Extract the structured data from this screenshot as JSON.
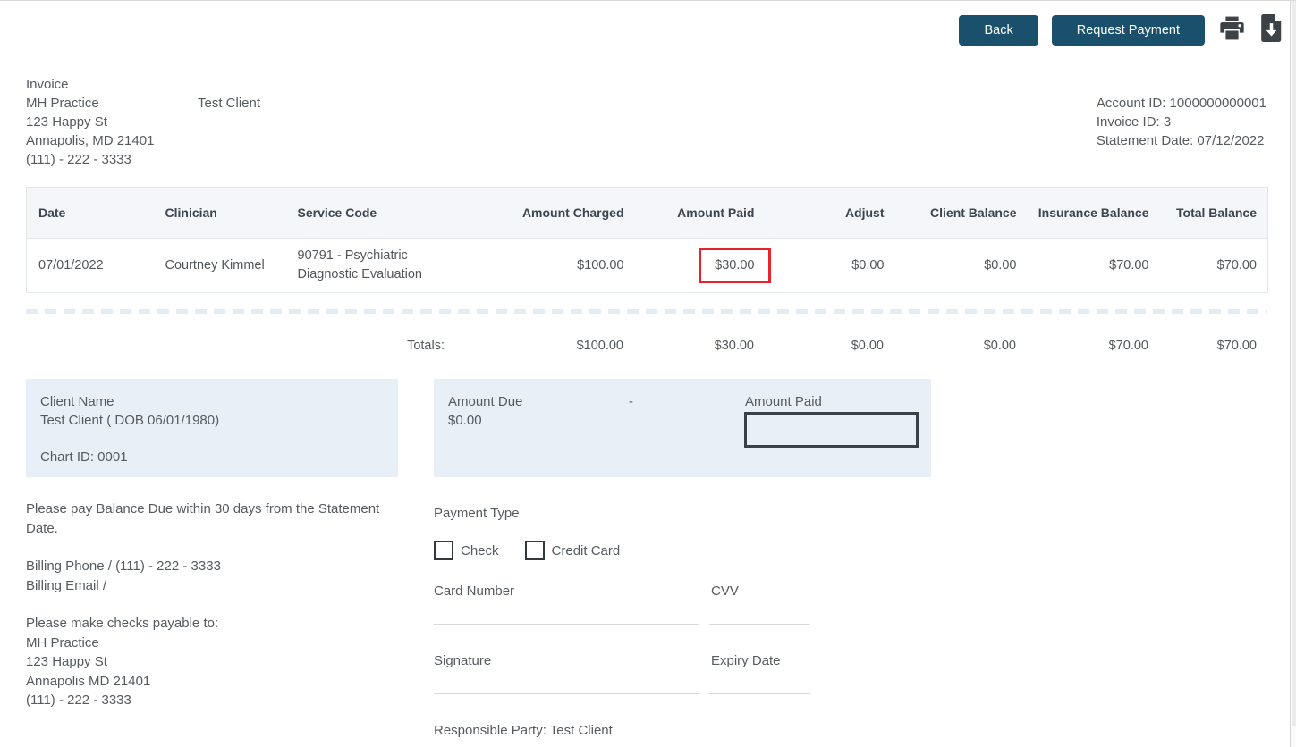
{
  "toolbar": {
    "back_label": "Back",
    "request_payment_label": "Request Payment"
  },
  "header": {
    "title": "Invoice",
    "practice_name": "MH Practice",
    "client_name": "Test Client",
    "address_line1": "123 Happy St",
    "address_line2": "Annapolis, MD 21401",
    "phone": "(111) - 222 - 3333",
    "account_id": "Account ID: 1000000000001",
    "invoice_id": "Invoice ID: 3",
    "statement_date": "Statement Date: 07/12/2022"
  },
  "table": {
    "columns": [
      "Date",
      "Clinician",
      "Service Code",
      "Amount Charged",
      "Amount Paid",
      "Adjust",
      "Client Balance",
      "Insurance Balance",
      "Total Balance"
    ],
    "rows": [
      {
        "date": "07/01/2022",
        "clinician": "Courtney Kimmel",
        "service_code": "90791 - Psychiatric Diagnostic Evaluation",
        "amount_charged": "$100.00",
        "amount_paid": "$30.00",
        "adjust": "$0.00",
        "client_balance": "$0.00",
        "insurance_balance": "$70.00",
        "total_balance": "$70.00"
      }
    ],
    "totals_label": "Totals:",
    "totals": {
      "amount_charged": "$100.00",
      "amount_paid": "$30.00",
      "adjust": "$0.00",
      "client_balance": "$0.00",
      "insurance_balance": "$70.00",
      "total_balance": "$70.00"
    }
  },
  "client_box": {
    "label": "Client Name",
    "name_dob": "Test Client ( DOB 06/01/1980)",
    "chart_id": "Chart ID: 0001"
  },
  "amount_box": {
    "due_label": "Amount Due",
    "due_value": "$0.00",
    "separator": "-",
    "paid_label": "Amount Paid",
    "paid_value": ""
  },
  "instructions": {
    "pay_notice": "Please pay Balance Due within 30 days from the Statement Date.",
    "billing_phone": "Billing Phone / (111) - 222 - 3333",
    "billing_email": "Billing Email /",
    "checks_payable": "Please make checks payable to:",
    "payee_name": "MH Practice",
    "payee_address1": "123 Happy St",
    "payee_address2": "Annapolis MD 21401",
    "payee_phone": "(111) - 222 - 3333"
  },
  "payment_form": {
    "type_label": "Payment Type",
    "check_label": "Check",
    "credit_card_label": "Credit Card",
    "card_number_label": "Card Number",
    "cvv_label": "CVV",
    "signature_label": "Signature",
    "expiry_label": "Expiry Date",
    "responsible_party": "Responsible Party: Test Client"
  },
  "colors": {
    "button_bg": "#1a506b",
    "highlight_red": "#e8232b",
    "panel_bg": "#e9eff7"
  }
}
